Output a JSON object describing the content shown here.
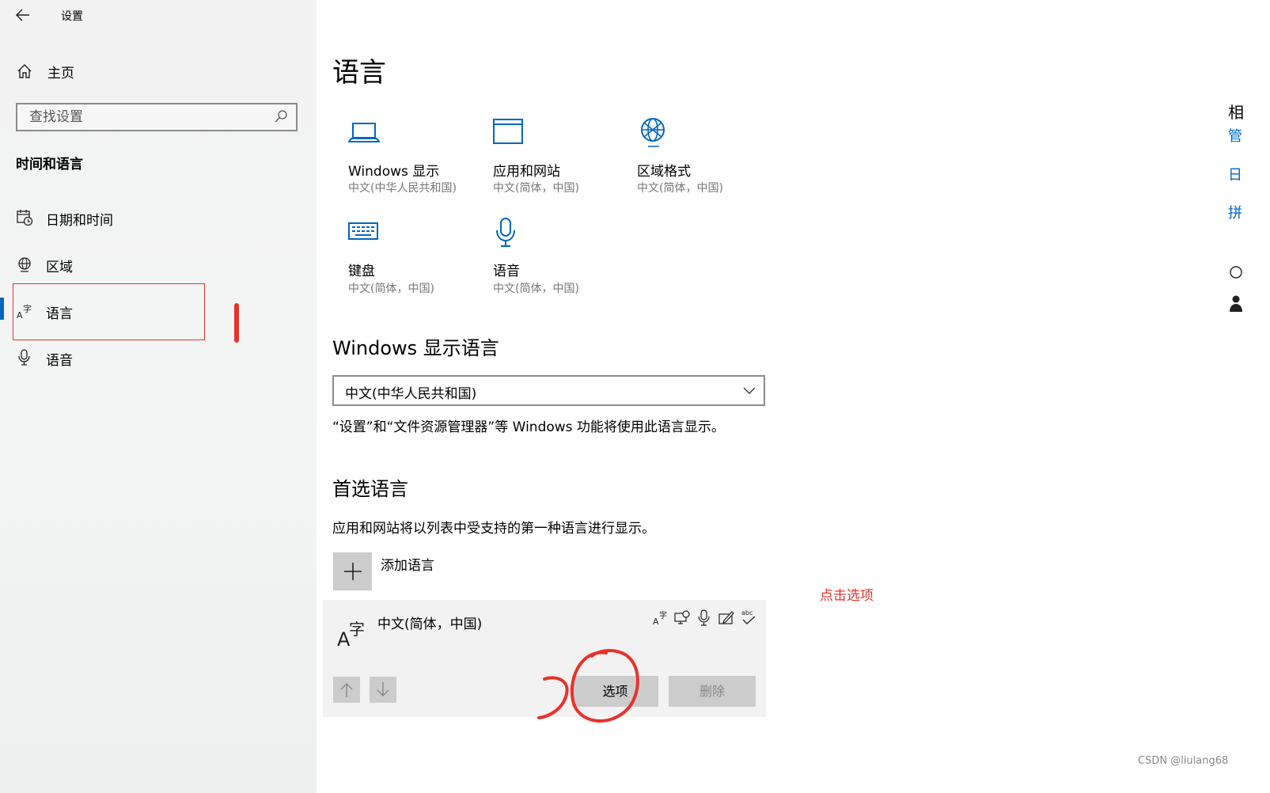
{
  "window": {
    "title": "设置"
  },
  "nav": {
    "home": "主页",
    "search_placeholder": "查找设置",
    "section": "时间和语言",
    "items": [
      {
        "label": "日期和时间",
        "icon": "calendar-clock-icon"
      },
      {
        "label": "区域",
        "icon": "globe-icon"
      },
      {
        "label": "语言",
        "icon": "language-icon",
        "selected": true
      },
      {
        "label": "语音",
        "icon": "microphone-icon"
      }
    ]
  },
  "main": {
    "title": "语言",
    "tiles": [
      {
        "title": "Windows 显示",
        "sub": "中文(中华人民共和国)",
        "icon": "laptop-icon"
      },
      {
        "title": "应用和网站",
        "sub": "中文(简体，中国)",
        "icon": "window-icon"
      },
      {
        "title": "区域格式",
        "sub": "中文(简体，中国)",
        "icon": "globe-format-icon"
      },
      {
        "title": "键盘",
        "sub": "中文(简体，中国)",
        "icon": "keyboard-icon"
      },
      {
        "title": "语音",
        "sub": "中文(简体，中国)",
        "icon": "microphone-icon"
      }
    ],
    "display_language": {
      "heading": "Windows 显示语言",
      "selected": "中文(中华人民共和国)",
      "description": "“设置”和“文件资源管理器”等 Windows 功能将使用此语言显示。"
    },
    "preferred": {
      "heading": "首选语言",
      "description": "应用和网站将以列表中受支持的第一种语言进行显示。",
      "add_label": "添加语言",
      "language_name": "中文(简体，中国)",
      "options_label": "选项",
      "remove_label": "删除"
    }
  },
  "right_edge": {
    "chars": [
      "相",
      "管",
      "日",
      "拼"
    ]
  },
  "annotation": {
    "hint": "点击选项",
    "color": "#e8312c"
  },
  "watermark": "CSDN @liulang68",
  "colors": {
    "accent": "#0067c0"
  }
}
